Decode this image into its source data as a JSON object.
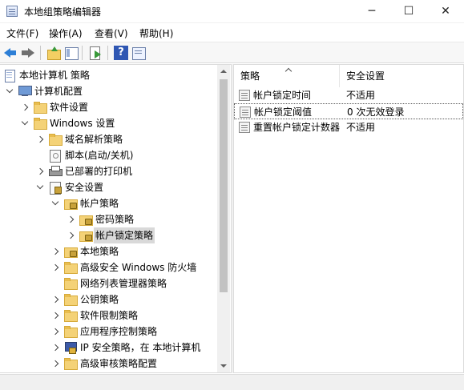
{
  "window": {
    "title": "本地组策略编辑器",
    "minimize": "─",
    "maximize": "☐",
    "close": "✕"
  },
  "menu": [
    {
      "label": "文件(F)"
    },
    {
      "label": "操作(A)"
    },
    {
      "label": "查看(V)"
    },
    {
      "label": "帮助(H)"
    }
  ],
  "toolbar": {
    "help_label": "?"
  },
  "tree": [
    {
      "label": "本地计算机 策略",
      "icon": "doc-icon",
      "chevron": "none"
    },
    {
      "label": "计算机配置",
      "icon": "computer-icon",
      "chevron": "down"
    },
    {
      "label": "软件设置",
      "icon": "folder-icon",
      "chevron": "right"
    },
    {
      "label": "Windows 设置",
      "icon": "folder-icon",
      "chevron": "down"
    },
    {
      "label": "域名解析策略",
      "icon": "folder-icon",
      "chevron": "right"
    },
    {
      "label": "脚本(启动/关机)",
      "icon": "script-icon",
      "chevron": "none"
    },
    {
      "label": "已部署的打印机",
      "icon": "printer-icon",
      "chevron": "right"
    },
    {
      "label": "安全设置",
      "icon": "security-icon",
      "chevron": "down"
    },
    {
      "label": "帐户策略",
      "icon": "lock-folder-icon",
      "chevron": "down"
    },
    {
      "label": "密码策略",
      "icon": "lock-folder-icon",
      "chevron": "right"
    },
    {
      "label": "帐户锁定策略",
      "icon": "lock-folder-icon",
      "chevron": "right",
      "selected": true
    },
    {
      "label": "本地策略",
      "icon": "lock-folder-icon",
      "chevron": "right"
    },
    {
      "label": "高级安全 Windows 防火墙",
      "icon": "folder-icon",
      "chevron": "right"
    },
    {
      "label": "网络列表管理器策略",
      "icon": "folder-icon",
      "chevron": "none"
    },
    {
      "label": "公钥策略",
      "icon": "folder-icon",
      "chevron": "right"
    },
    {
      "label": "软件限制策略",
      "icon": "folder-icon",
      "chevron": "right"
    },
    {
      "label": "应用程序控制策略",
      "icon": "folder-icon",
      "chevron": "right"
    },
    {
      "label": "IP 安全策略，在 本地计算机",
      "icon": "ipsec-icon",
      "chevron": "right"
    },
    {
      "label": "高级审核策略配置",
      "icon": "folder-icon",
      "chevron": "right"
    }
  ],
  "policy_table": {
    "columns": [
      "策略",
      "安全设置"
    ],
    "rows": [
      {
        "name": "帐户锁定时间",
        "value": "不适用"
      },
      {
        "name": "帐户锁定阈值",
        "value": "0 次无效登录",
        "focused": true
      },
      {
        "name": "重置帐户锁定计数器",
        "value": "不适用"
      }
    ]
  }
}
